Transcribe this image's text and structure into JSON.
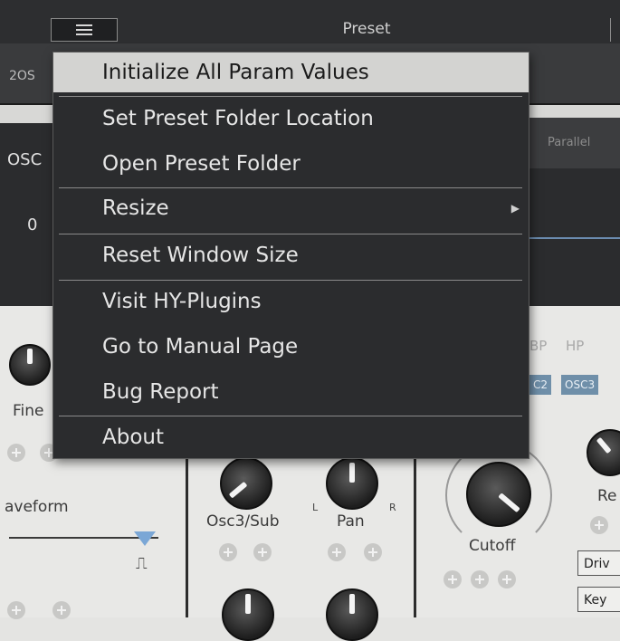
{
  "header": {
    "title": "Preset",
    "menu_icon": "hamburger-icon"
  },
  "strip": {
    "tab_label": "2OS"
  },
  "osc_panel": {
    "label": "OSC",
    "value": "0",
    "mode": "Parallel"
  },
  "filter": {
    "types": [
      "BP",
      "HP"
    ],
    "routes": [
      "C2",
      "OSC3"
    ]
  },
  "controls": {
    "fine": "Fine",
    "waveform": "aveform",
    "osc3sub": "Osc3/Sub",
    "pan": "Pan",
    "pan_l": "L",
    "pan_r": "R",
    "cutoff": "Cutoff",
    "res": "Re",
    "drive": "Driv",
    "key": "Key"
  },
  "menu": {
    "items": [
      {
        "label": "Initialize All Param Values",
        "highlighted": true
      },
      {
        "label": "Set Preset Folder Location"
      },
      {
        "label": "Open Preset Folder"
      },
      {
        "label": "Resize",
        "submenu": true
      },
      {
        "label": "Reset Window Size"
      },
      {
        "label": "Visit HY-Plugins"
      },
      {
        "label": "Go to Manual Page"
      },
      {
        "label": "Bug Report"
      },
      {
        "label": "About"
      }
    ]
  },
  "colors": {
    "accent": "#6f8fa9",
    "menu_bg": "#2b2c2e",
    "highlight": "#d3d3d1"
  }
}
